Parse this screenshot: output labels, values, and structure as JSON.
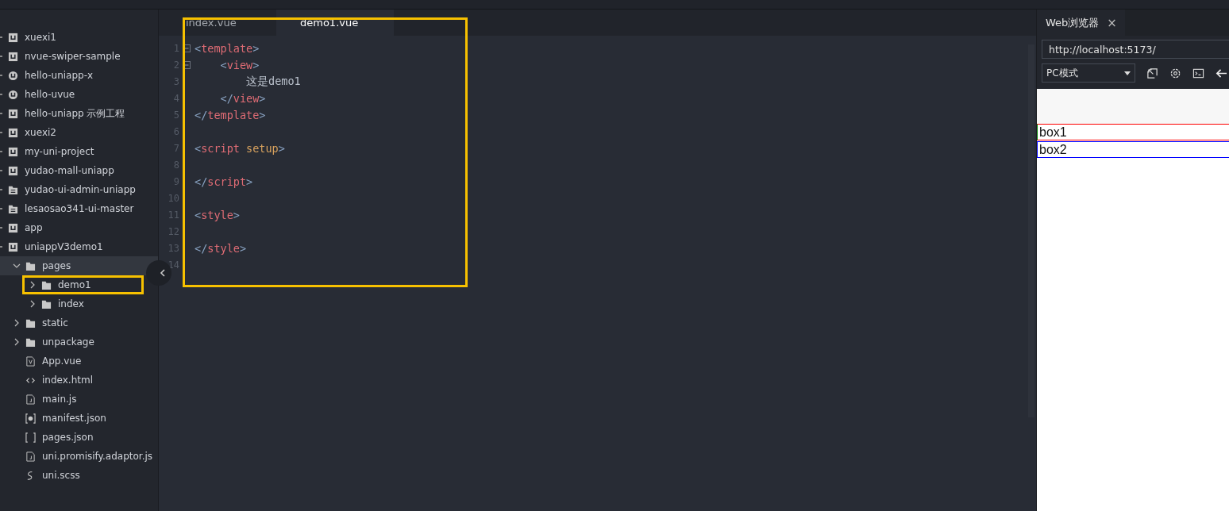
{
  "explorer": {
    "items": [
      {
        "label": "xuexi1",
        "kind": "uni"
      },
      {
        "label": "nvue-swiper-sample",
        "kind": "uni"
      },
      {
        "label": "hello-uniapp-x",
        "kind": "uni-x"
      },
      {
        "label": "hello-uvue",
        "kind": "uni-x"
      },
      {
        "label": "hello-uniapp 示例工程",
        "kind": "uni"
      },
      {
        "label": "xuexi2",
        "kind": "uni"
      },
      {
        "label": "my-uni-project",
        "kind": "uni"
      },
      {
        "label": "yudao-mall-uniapp",
        "kind": "uni"
      },
      {
        "label": "yudao-ui-admin-uniapp",
        "kind": "project"
      },
      {
        "label": "lesaosao341-ui-master",
        "kind": "project"
      },
      {
        "label": "app",
        "kind": "uni"
      },
      {
        "label": "uniappV3demo1",
        "kind": "uni",
        "children": [
          {
            "label": "pages",
            "kind": "folder",
            "expanded": true,
            "selected": true,
            "children": [
              {
                "label": "demo1",
                "kind": "folder",
                "expanded": false,
                "highlighted": true
              },
              {
                "label": "index",
                "kind": "folder",
                "expanded": false
              }
            ]
          },
          {
            "label": "static",
            "kind": "folder",
            "expanded": false
          },
          {
            "label": "unpackage",
            "kind": "folder",
            "expanded": false
          },
          {
            "label": "App.vue",
            "kind": "vue"
          },
          {
            "label": "index.html",
            "kind": "html"
          },
          {
            "label": "main.js",
            "kind": "js"
          },
          {
            "label": "manifest.json",
            "kind": "manifest"
          },
          {
            "label": "pages.json",
            "kind": "json"
          },
          {
            "label": "uni.promisify.adaptor.js",
            "kind": "js"
          },
          {
            "label": "uni.scss",
            "kind": "scss"
          }
        ]
      }
    ]
  },
  "editor": {
    "highlighted": true,
    "tabs": [
      {
        "label": "index.vue",
        "selected": false
      },
      {
        "label": "demo1.vue",
        "selected": true
      }
    ],
    "lines": [
      {
        "number": "1",
        "fold": true,
        "tokens": [
          {
            "kind": "punct",
            "text": "<"
          },
          {
            "kind": "tag",
            "text": "template"
          },
          {
            "kind": "punct",
            "text": ">"
          }
        ]
      },
      {
        "number": "2",
        "fold": true,
        "tokens": [
          {
            "kind": "punct",
            "text": "    <"
          },
          {
            "kind": "tag",
            "text": "view"
          },
          {
            "kind": "punct",
            "text": ">"
          }
        ]
      },
      {
        "number": "3",
        "tokens": [
          {
            "kind": "text",
            "text": "        这是demo1"
          }
        ]
      },
      {
        "number": "4",
        "tokens": [
          {
            "kind": "punct",
            "text": "    </"
          },
          {
            "kind": "tag",
            "text": "view"
          },
          {
            "kind": "punct",
            "text": ">"
          }
        ]
      },
      {
        "number": "5",
        "tokens": [
          {
            "kind": "punct",
            "text": "</"
          },
          {
            "kind": "tag",
            "text": "template"
          },
          {
            "kind": "punct",
            "text": ">"
          }
        ]
      },
      {
        "number": "6"
      },
      {
        "number": "7",
        "tokens": [
          {
            "kind": "punct",
            "text": "<"
          },
          {
            "kind": "tag",
            "text": "script"
          },
          {
            "kind": "attr",
            "text": " setup"
          },
          {
            "kind": "punct",
            "text": ">"
          }
        ]
      },
      {
        "number": "8"
      },
      {
        "number": "9",
        "tokens": [
          {
            "kind": "punct",
            "text": "</"
          },
          {
            "kind": "tag",
            "text": "script"
          },
          {
            "kind": "punct",
            "text": ">"
          }
        ]
      },
      {
        "number": "10"
      },
      {
        "number": "11",
        "tokens": [
          {
            "kind": "punct",
            "text": "<"
          },
          {
            "kind": "tag",
            "text": "style"
          },
          {
            "kind": "punct",
            "text": ">"
          }
        ]
      },
      {
        "number": "12"
      },
      {
        "number": "13",
        "tokens": [
          {
            "kind": "punct",
            "text": "</"
          },
          {
            "kind": "tag",
            "text": "style"
          },
          {
            "kind": "punct",
            "text": ">"
          }
        ]
      },
      {
        "number": "14"
      }
    ]
  },
  "browser": {
    "tab": {
      "label": "Web浏览器",
      "close": "×"
    },
    "url": "http://localhost:5173/",
    "mode": "PC模式",
    "preview": [
      {
        "text": "box1",
        "color": "#ff0000"
      },
      {
        "text": "box2",
        "color": "#0000ff"
      }
    ]
  }
}
